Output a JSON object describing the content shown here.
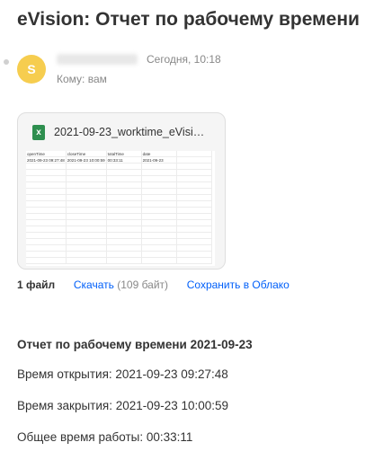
{
  "subject": "eVision: Отчет по рабочему времени",
  "sender": {
    "avatar_letter": "S",
    "avatar_color": "#f6cd4f"
  },
  "date": "Сегодня, 10:18",
  "recipient": "Кому: вам",
  "attachment": {
    "file_name": "2021-09-23_worktime_eVisi…",
    "icon": "excel-file-icon",
    "preview": {
      "headers": [
        "openTime",
        "closeTime",
        "totalTime",
        "date"
      ],
      "row": [
        "2021-09-23 09:27:48",
        "2021-09-23 10:00:59",
        "00:33:11",
        "2021-09-23"
      ]
    }
  },
  "files_bar": {
    "count_label": "1 файл",
    "download_label": "Скачать",
    "size_label": "(109 байт)",
    "save_label": "Сохранить в Облако"
  },
  "body": {
    "title": "Отчет по рабочему времени 2021-09-23",
    "open_time": "Время открытия: 2021-09-23 09:27:48",
    "close_time": "Время закрытия: 2021-09-23 10:00:59",
    "total_time": "Общее время работы: 00:33:11"
  },
  "colors": {
    "link": "#005ff9",
    "muted": "#888888",
    "excel": "#2e8f4f"
  }
}
